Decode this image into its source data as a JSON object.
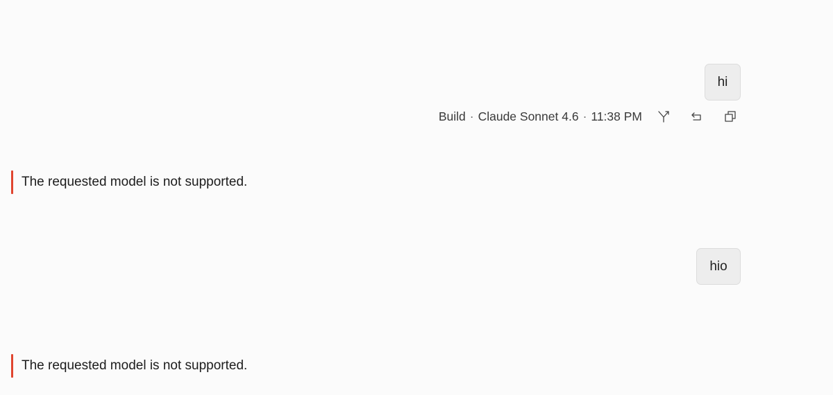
{
  "messages": [
    {
      "role": "user",
      "text": "hi"
    },
    {
      "role": "assistant_error",
      "text": "The requested model is not supported."
    },
    {
      "role": "user",
      "text": "hio"
    },
    {
      "role": "assistant_error",
      "text": "The requested model is not supported."
    }
  ],
  "meta": {
    "mode": "Build",
    "model": "Claude Sonnet 4.6",
    "time": "11:38 PM",
    "separator": "·"
  },
  "actions": [
    {
      "icon": "branch-icon"
    },
    {
      "icon": "revert-icon"
    },
    {
      "icon": "copy-icon"
    }
  ],
  "colors": {
    "error_accent": "#e0452f",
    "bubble_bg": "#ededed",
    "page_bg": "#fbfbfb"
  }
}
